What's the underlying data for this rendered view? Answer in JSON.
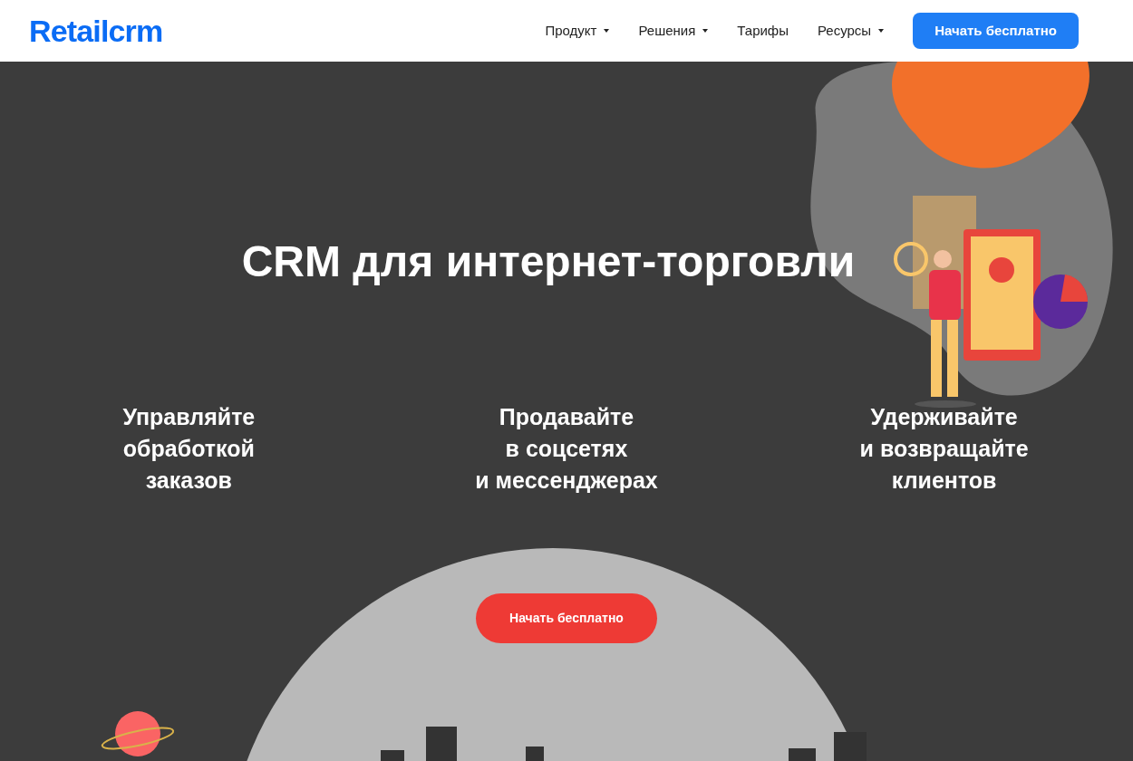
{
  "header": {
    "logo": "Retailcrm",
    "nav": [
      {
        "label": "Продукт",
        "has_dropdown": true
      },
      {
        "label": "Решения",
        "has_dropdown": true
      },
      {
        "label": "Тарифы",
        "has_dropdown": false
      },
      {
        "label": "Ресурсы",
        "has_dropdown": true
      }
    ],
    "cta": "Начать бесплатно"
  },
  "hero": {
    "title": "CRM для интернет-торговли",
    "features": [
      [
        "Управляйте",
        "обработкой",
        "заказов"
      ],
      [
        "Продавайте",
        "в соцсетях",
        "и мессенджерах"
      ],
      [
        "Удерживайте",
        "и возвращайте",
        "клиентов"
      ]
    ],
    "cta": "Начать бесплатно"
  }
}
